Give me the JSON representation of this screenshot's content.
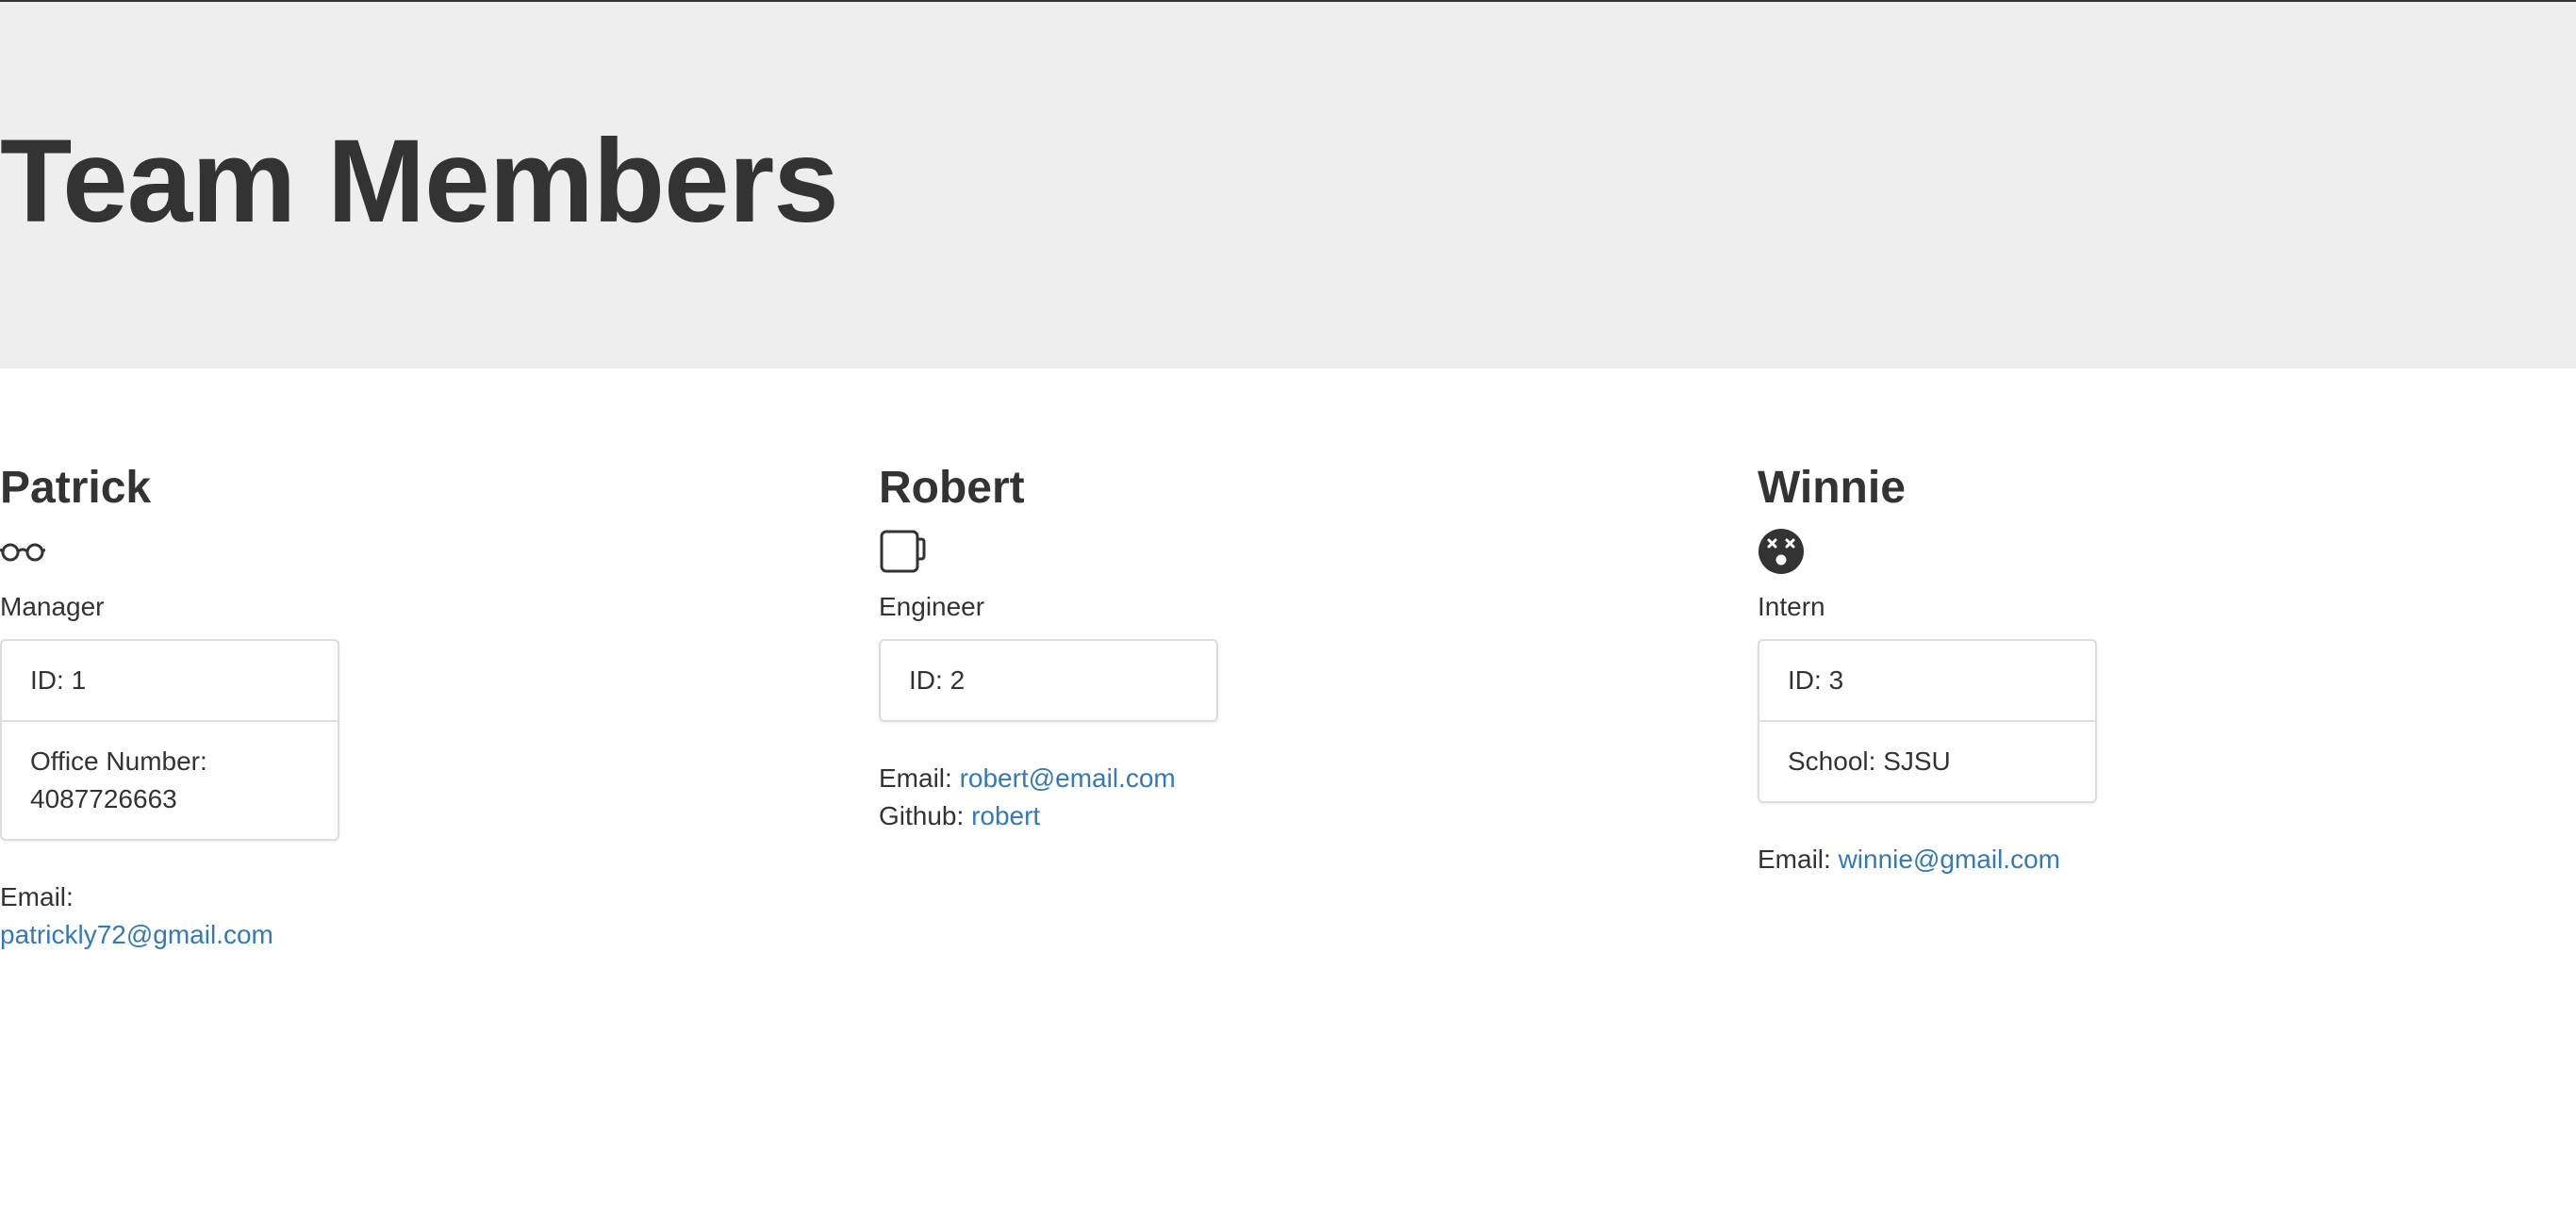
{
  "header": {
    "title": "Team Members"
  },
  "members": [
    {
      "name": "Patrick",
      "icon": "glasses-icon",
      "role": "Manager",
      "details": [
        {
          "label": "ID:",
          "value": "1"
        },
        {
          "label": "Office Number:",
          "value": "4087726663"
        }
      ],
      "email_label": "Email:",
      "email": "patrickly72@gmail.com"
    },
    {
      "name": "Robert",
      "icon": "mug-icon",
      "role": "Engineer",
      "details": [
        {
          "label": "ID:",
          "value": "2"
        }
      ],
      "email_label": "Email:",
      "email": "robert@email.com",
      "github_label": "Github:",
      "github": "robert"
    },
    {
      "name": "Winnie",
      "icon": "dizzy-face-icon",
      "role": "Intern",
      "details": [
        {
          "label": "ID:",
          "value": "3"
        },
        {
          "label": "School:",
          "value": "SJSU"
        }
      ],
      "email_label": "Email:",
      "email": "winnie@gmail.com"
    }
  ],
  "colors": {
    "header_bg": "#eeeeee",
    "text": "#333333",
    "link": "#337ab7",
    "border": "#dddddd"
  }
}
